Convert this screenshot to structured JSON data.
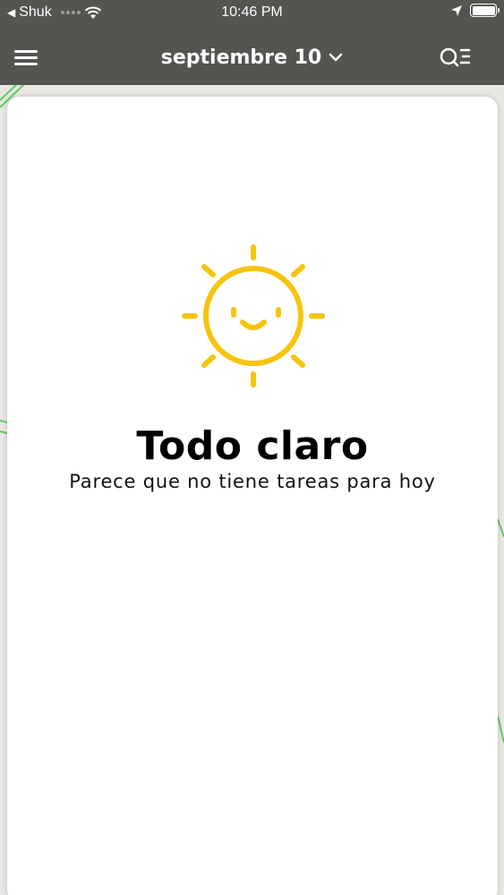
{
  "status_bar": {
    "back_app": "Shuk",
    "time": "10:46 PM"
  },
  "header": {
    "title": "septiembre 10",
    "background_color": "#555451"
  },
  "empty_state": {
    "title": "Todo claro",
    "subtitle": "Parece que no tiene tareas para hoy",
    "icon": "smiling-sun-icon",
    "icon_color": "#f5c40f"
  },
  "accent_line_color": "#63c964"
}
